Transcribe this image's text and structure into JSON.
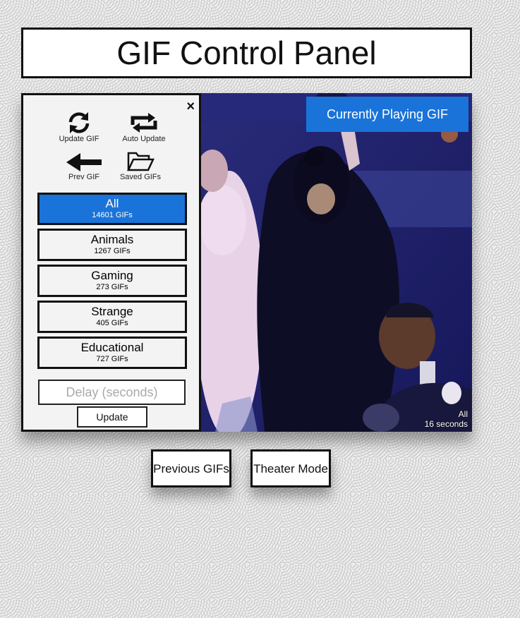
{
  "header": {
    "title": "GIF Control Panel"
  },
  "sidebar": {
    "close_label": "×",
    "tools": {
      "update_gif": "Update GIF",
      "auto_update": "Auto Update",
      "prev_gif": "Prev GIF",
      "saved_gifs": "Saved GIFs"
    },
    "categories": [
      {
        "name": "All",
        "count": "14601 GIFs",
        "active": true
      },
      {
        "name": "Animals",
        "count": "1267 GIFs"
      },
      {
        "name": "Gaming",
        "count": "273 GIFs"
      },
      {
        "name": "Strange",
        "count": "405 GIFs"
      },
      {
        "name": "Educational",
        "count": "727 GIFs"
      }
    ],
    "delay": {
      "placeholder": "Delay (seconds)",
      "value": ""
    },
    "update_label": "Update"
  },
  "viewer": {
    "now_playing_label": "Currently Playing GIF",
    "category": "All",
    "duration": "16 seconds"
  },
  "bottom_buttons": {
    "previous": "Previous GIFs",
    "theater": "Theater Mode"
  },
  "colors": {
    "accent": "#1a73d9",
    "border": "#111111",
    "panel_bg": "#f3f3f3"
  }
}
